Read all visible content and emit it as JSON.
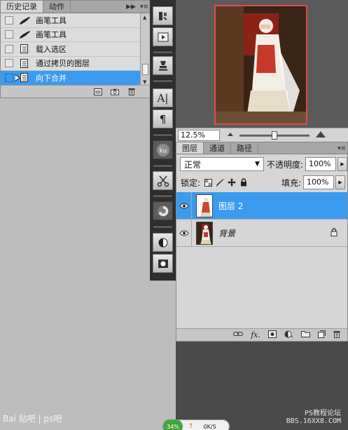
{
  "history_panel": {
    "tabs": [
      "历史记录",
      "动作"
    ],
    "items": [
      {
        "label": "画笔工具",
        "icon": "brush-icon"
      },
      {
        "label": "画笔工具",
        "icon": "brush-icon"
      },
      {
        "label": "载入选区",
        "icon": "document-icon"
      },
      {
        "label": "通过拷贝的图层",
        "icon": "document-icon"
      },
      {
        "label": "向下合并",
        "icon": "document-icon",
        "selected": true
      }
    ]
  },
  "navigator": {
    "zoom": "12.5%"
  },
  "layers_panel": {
    "tabs": [
      "图层",
      "通道",
      "路径"
    ],
    "blend_mode": "正常",
    "opacity_label": "不透明度:",
    "opacity_value": "100%",
    "lock_label": "锁定:",
    "fill_label": "填充:",
    "fill_value": "100%",
    "layers": [
      {
        "name": "图层 2",
        "selected": true,
        "visible": true
      },
      {
        "name": "背景",
        "selected": false,
        "visible": true,
        "locked": true
      }
    ]
  },
  "watermarks": {
    "baidu": "Bai 贴吧 | ps吧",
    "ps_forum_line1": "PS教程论坛",
    "ps_forum_line2": "BBS.16XX8.COM"
  },
  "net_widget": {
    "percent": "34%",
    "speed": "0K/S"
  },
  "colors": {
    "selection": "#3a9bf0",
    "panel_bg": "#d6d6d6",
    "dock_bg": "#2f2f2f",
    "nav_frame": "#e04c4c"
  }
}
